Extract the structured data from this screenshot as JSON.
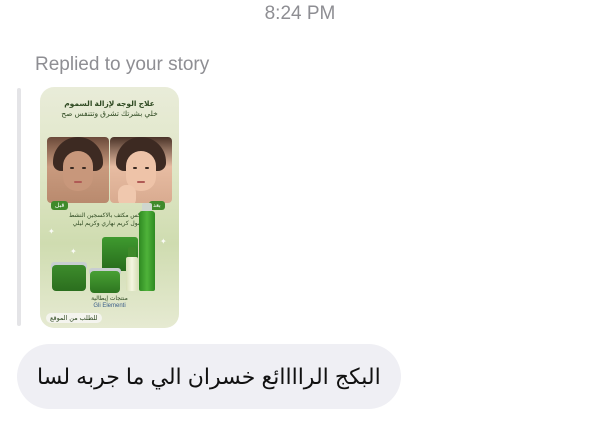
{
  "timestamp": "8:24 PM",
  "reply": {
    "label": "Replied to your story"
  },
  "story": {
    "title_line1": "علاج الوجه لإزالة السموم",
    "title_line2": "خلي بشرتك تشرق وتتنفس صح",
    "before_tag": "قبل",
    "after_tag": "بعد",
    "subtitle_line1": "ديتوكس مكثف بالاكسجين النشط",
    "subtitle_line2": "غسول كريم نهاري وكريم ليلي",
    "brand_line": "منتجات إيطالية",
    "brand_logo": "Gli Elementi",
    "order_label": "للطلب من الموقع"
  },
  "message": {
    "text": "البكج الراااائع خسران الي ما جربه لسا"
  }
}
